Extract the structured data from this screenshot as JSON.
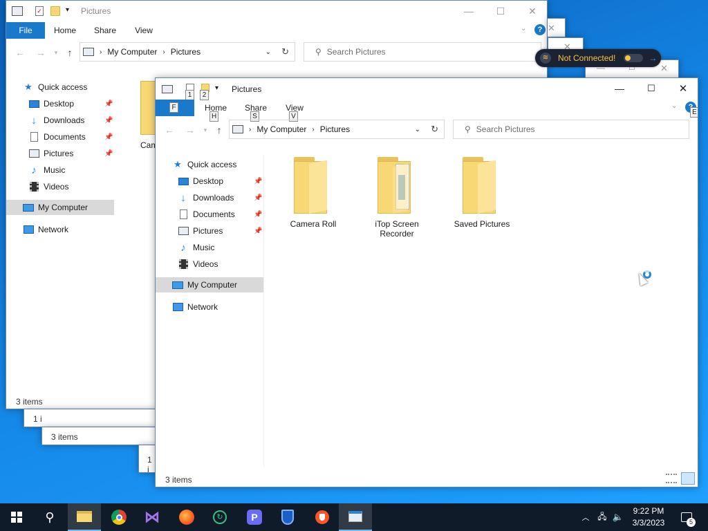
{
  "windows": {
    "back": {
      "title": "Pictures",
      "ribbon_tabs": [
        "File",
        "Home",
        "Share",
        "View"
      ],
      "breadcrumb": [
        "My Computer",
        "Pictures"
      ],
      "search_placeholder": "Search Pictures",
      "partial_item": "Cam",
      "status": "3 items"
    },
    "stack": {
      "status_a": "1 i",
      "status_b": "3 items",
      "status_c": "1 i"
    },
    "front": {
      "title": "Pictures",
      "ribbon_tabs": [
        "Home",
        "Share",
        "View"
      ],
      "keytips": {
        "qat1": "1",
        "qat2": "2",
        "file": "F",
        "home": "H",
        "share": "S",
        "view": "V",
        "help": "E"
      },
      "breadcrumb": [
        "My Computer",
        "Pictures"
      ],
      "search_placeholder": "Search Pictures",
      "status": "3 items",
      "items": [
        {
          "name": "Camera Roll",
          "icon": "folder-icon"
        },
        {
          "name": "iTop Screen Recorder",
          "icon": "folder-with-documents-icon"
        },
        {
          "name": "Saved Pictures",
          "icon": "folder-icon"
        }
      ]
    }
  },
  "nav": {
    "quick_access": "Quick access",
    "items": [
      {
        "label": "Desktop",
        "icon": "desktop-icon",
        "pinned": true
      },
      {
        "label": "Downloads",
        "icon": "download-arrow-icon",
        "pinned": true
      },
      {
        "label": "Documents",
        "icon": "document-icon",
        "pinned": true
      },
      {
        "label": "Pictures",
        "icon": "pictures-icon",
        "pinned": true
      },
      {
        "label": "Music",
        "icon": "music-note-icon",
        "pinned": false
      },
      {
        "label": "Videos",
        "icon": "film-icon",
        "pinned": false
      }
    ],
    "computer": "My Computer",
    "network": "Network"
  },
  "vpn_popup": {
    "status": "Not Connected!"
  },
  "taskbar": {
    "apps": [
      "start-icon",
      "search-icon",
      "file-explorer-icon",
      "chrome-icon",
      "visual-studio-icon",
      "firefox-icon",
      "circle-app-icon",
      "p-app-icon",
      "shield-app-icon",
      "brave-icon",
      "window-app-icon"
    ],
    "time": "9:22 PM",
    "date": "3/3/2023",
    "notification_count": "5"
  },
  "colors": {
    "accent": "#1979ca",
    "folder": "#f8d775",
    "taskbar": "#101b2a",
    "vpn_text": "#f6c343"
  }
}
